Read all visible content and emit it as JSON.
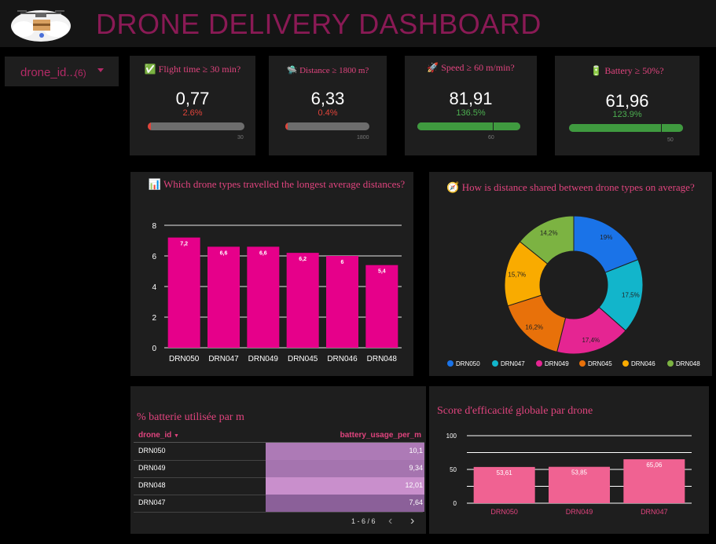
{
  "header": {
    "title": "DRONE DELIVERY DASHBOARD"
  },
  "filter": {
    "label": "drone_id...",
    "count": "(6)"
  },
  "kpis": [
    {
      "icon": "✅",
      "title": "Flight time ≥ 30 min?",
      "value": "0,77",
      "delta": "2.6%",
      "delta_color": "#e0443a",
      "target_label": "30",
      "progress": 0.026,
      "fill_color": "#e0443a"
    },
    {
      "icon": "🛸",
      "title": "Distance ≥ 1800 m?",
      "value": "6,33",
      "delta": "0.4%",
      "delta_color": "#e0443a",
      "target_label": "1800",
      "progress": 0.004,
      "fill_color": "#e0443a"
    },
    {
      "icon": "🚀",
      "title": "Speed ≥ 60 m/min?",
      "value": "81,91",
      "delta": "136.5%",
      "delta_color": "#4caf50",
      "target_label": "60",
      "progress": 1.0,
      "target_ratio": 0.732,
      "fill_color": "#3f9a3f"
    },
    {
      "icon": "🔋",
      "title": "Battery ≥ 50%?",
      "value": "61,96",
      "delta": "123.9%",
      "delta_color": "#4caf50",
      "target_label": "50",
      "progress": 1.0,
      "target_ratio": 0.807,
      "fill_color": "#3f9a3f"
    }
  ],
  "bar_panel": {
    "icon": "📊",
    "title": "Which drone types travelled the longest average distances?"
  },
  "pie_panel": {
    "icon": "🧭",
    "title": "How is distance shared between drone types on average?"
  },
  "table_panel": {
    "title": "% batterie utilisée par m",
    "col_id": "drone_id",
    "col_value": "battery_usage_per_m",
    "rows": [
      {
        "id": "DRN050",
        "value": "10,1",
        "shade": 0.62
      },
      {
        "id": "DRN049",
        "value": "9,34",
        "shade": 0.52
      },
      {
        "id": "DRN048",
        "value": "12,01",
        "shade": 0.95
      },
      {
        "id": "DRN047",
        "value": "7,64",
        "shade": 0.2
      }
    ],
    "pagination": "1 - 6 / 6",
    "prev_icon": "‹",
    "next_icon": "›"
  },
  "eff_panel": {
    "title": "Score d'efficacité globale par drone"
  },
  "chart_data": [
    {
      "type": "bar",
      "categories": [
        "DRN050",
        "DRN047",
        "DRN049",
        "DRN045",
        "DRN046",
        "DRN048"
      ],
      "values": [
        7.2,
        6.6,
        6.6,
        6.2,
        6,
        5.4
      ],
      "labels": [
        "7,2",
        "6,6",
        "6,6",
        "6,2",
        "6",
        "5,4"
      ],
      "yticks": [
        "0",
        "2",
        "4",
        "6",
        "8"
      ],
      "ylim": [
        0,
        8
      ],
      "color": "#e6008a",
      "grid": true
    },
    {
      "type": "pie",
      "donut": true,
      "categories": [
        "DRN050",
        "DRN047",
        "DRN049",
        "DRN045",
        "DRN046",
        "DRN048"
      ],
      "values": [
        19,
        17.5,
        17.4,
        16.2,
        15.7,
        14.2
      ],
      "labels": [
        "19%",
        "17,5%",
        "17,4%",
        "16,2%",
        "15,7%",
        "14,2%"
      ],
      "colors": [
        "#1a73e8",
        "#12b5cb",
        "#e52592",
        "#e8710a",
        "#f9ab00",
        "#7cb342"
      ],
      "legend": "bottom"
    },
    {
      "type": "bar",
      "categories": [
        "DRN050",
        "DRN049",
        "DRN047"
      ],
      "values": [
        53.61,
        53.85,
        65.06
      ],
      "labels": [
        "53,61",
        "53,85",
        "65,06"
      ],
      "yticks": [
        "0",
        "50",
        "100"
      ],
      "ylim": [
        0,
        100
      ],
      "color": "#f06292",
      "grid": true
    }
  ]
}
